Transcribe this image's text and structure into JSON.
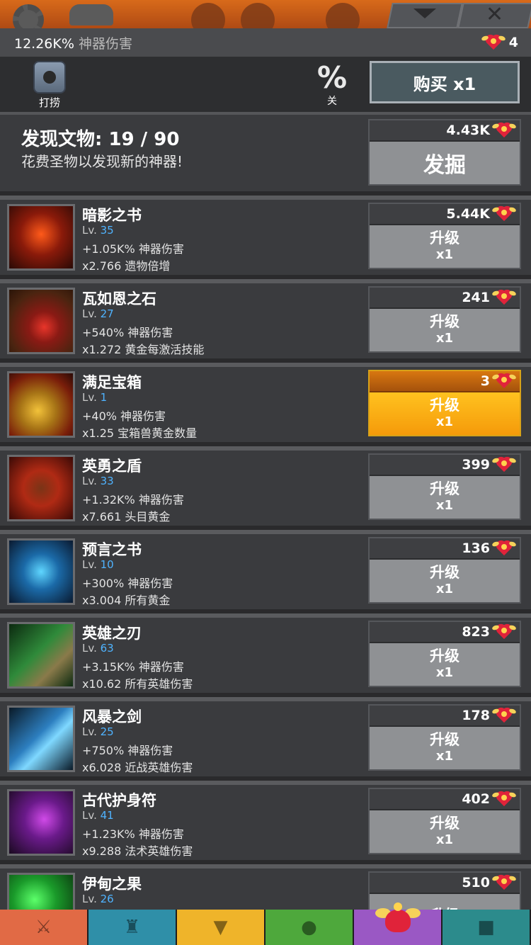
{
  "header": {
    "damage_value": "12.26K%",
    "damage_label": "神器伤害",
    "relic_count": "4"
  },
  "toolbar": {
    "salvage_label": "打捞",
    "percent_symbol": "%",
    "percent_label": "关",
    "buy_label": "购买 x1"
  },
  "discover": {
    "title": "发现文物: 19 / 90",
    "description": "花费圣物以发现新的神器!",
    "cost": "4.43K",
    "action_label": "发掘"
  },
  "artifacts": [
    {
      "name": "暗影之书",
      "lvl_prefix": "Lv.",
      "level": "35",
      "line1": "+1.05K% 神器伤害",
      "line2": "x2.766 遗物倍增",
      "cost": "5.44K",
      "action": "升级",
      "multiplier": "x1",
      "affordable": false
    },
    {
      "name": "瓦如恩之石",
      "lvl_prefix": "Lv.",
      "level": "27",
      "line1": "+540% 神器伤害",
      "line2": "x1.272 黄金每激活技能",
      "cost": "241",
      "action": "升级",
      "multiplier": "x1",
      "affordable": false
    },
    {
      "name": "满足宝箱",
      "lvl_prefix": "Lv.",
      "level": "1",
      "line1": "+40% 神器伤害",
      "line2": "x1.25 宝箱兽黄金数量",
      "cost": "3",
      "action": "升级",
      "multiplier": "x1",
      "affordable": true
    },
    {
      "name": "英勇之盾",
      "lvl_prefix": "Lv.",
      "level": "33",
      "line1": "+1.32K% 神器伤害",
      "line2": "x7.661 头目黄金",
      "cost": "399",
      "action": "升级",
      "multiplier": "x1",
      "affordable": false
    },
    {
      "name": "预言之书",
      "lvl_prefix": "Lv.",
      "level": "10",
      "line1": "+300% 神器伤害",
      "line2": "x3.004 所有黄金",
      "cost": "136",
      "action": "升级",
      "multiplier": "x1",
      "affordable": false
    },
    {
      "name": "英雄之刃",
      "lvl_prefix": "Lv.",
      "level": "63",
      "line1": "+3.15K% 神器伤害",
      "line2": "x10.62 所有英雄伤害",
      "cost": "823",
      "action": "升级",
      "multiplier": "x1",
      "affordable": false
    },
    {
      "name": "风暴之剑",
      "lvl_prefix": "Lv.",
      "level": "25",
      "line1": "+750% 神器伤害",
      "line2": "x6.028 近战英雄伤害",
      "cost": "178",
      "action": "升级",
      "multiplier": "x1",
      "affordable": false
    },
    {
      "name": "古代护身符",
      "lvl_prefix": "Lv.",
      "level": "41",
      "line1": "+1.23K% 神器伤害",
      "line2": "x9.288 法术英雄伤害",
      "cost": "402",
      "action": "升级",
      "multiplier": "x1",
      "affordable": false
    },
    {
      "name": "伊甸之果",
      "lvl_prefix": "Lv.",
      "level": "26",
      "line1": "",
      "line2": "",
      "cost": "510",
      "action": "升级",
      "multiplier": "",
      "affordable": false
    }
  ],
  "icons": {
    "relic": "winged-heart-icon",
    "salvage": "salvage-icon",
    "nav": [
      "sword-icon",
      "helmet-icon",
      "armor-icon",
      "pet-icon",
      "artifact-heart-icon",
      "shop-icon"
    ]
  },
  "colors": {
    "level_blue": "#4fb3ff",
    "affordable_gold": "#f59a0a",
    "disabled_gray": "#8f9194"
  }
}
